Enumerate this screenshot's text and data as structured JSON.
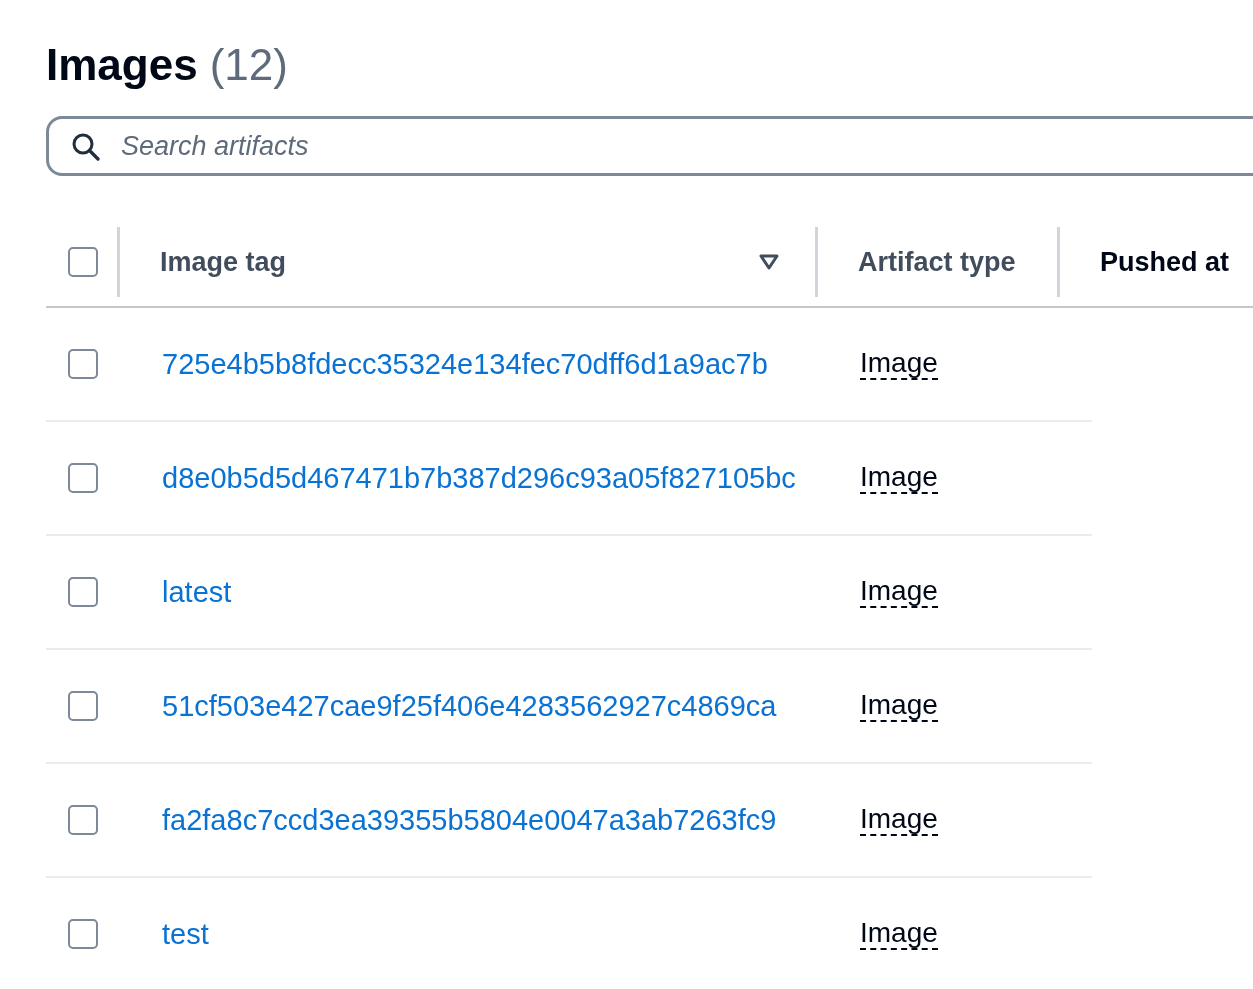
{
  "header": {
    "title": "Images",
    "count": "(12)"
  },
  "search": {
    "placeholder": "Search artifacts"
  },
  "table": {
    "select_all_checked": false,
    "columns": [
      {
        "label": "Image tag",
        "sorted": false,
        "sort_caret": true
      },
      {
        "label": "Artifact type",
        "sorted": false,
        "sort_caret": false
      },
      {
        "label": "Pushed at",
        "sorted": true,
        "sort_caret": false
      }
    ],
    "rows": [
      {
        "checked": false,
        "image_tag": "725e4b5b8fdecc35324e134fec70dff6d1a9ac7b",
        "artifact_type": "Image"
      },
      {
        "checked": false,
        "image_tag": "d8e0b5d5d467471b7b387d296c93a05f827105bc",
        "artifact_type": "Image"
      },
      {
        "checked": false,
        "image_tag": "latest",
        "artifact_type": "Image"
      },
      {
        "checked": false,
        "image_tag": "51cf503e427cae9f25f406e4283562927c4869ca",
        "artifact_type": "Image"
      },
      {
        "checked": false,
        "image_tag": "fa2fa8c7ccd3ea39355b5804e0047a3ab7263fc9",
        "artifact_type": "Image"
      },
      {
        "checked": false,
        "image_tag": "test",
        "artifact_type": "Image"
      }
    ]
  }
}
